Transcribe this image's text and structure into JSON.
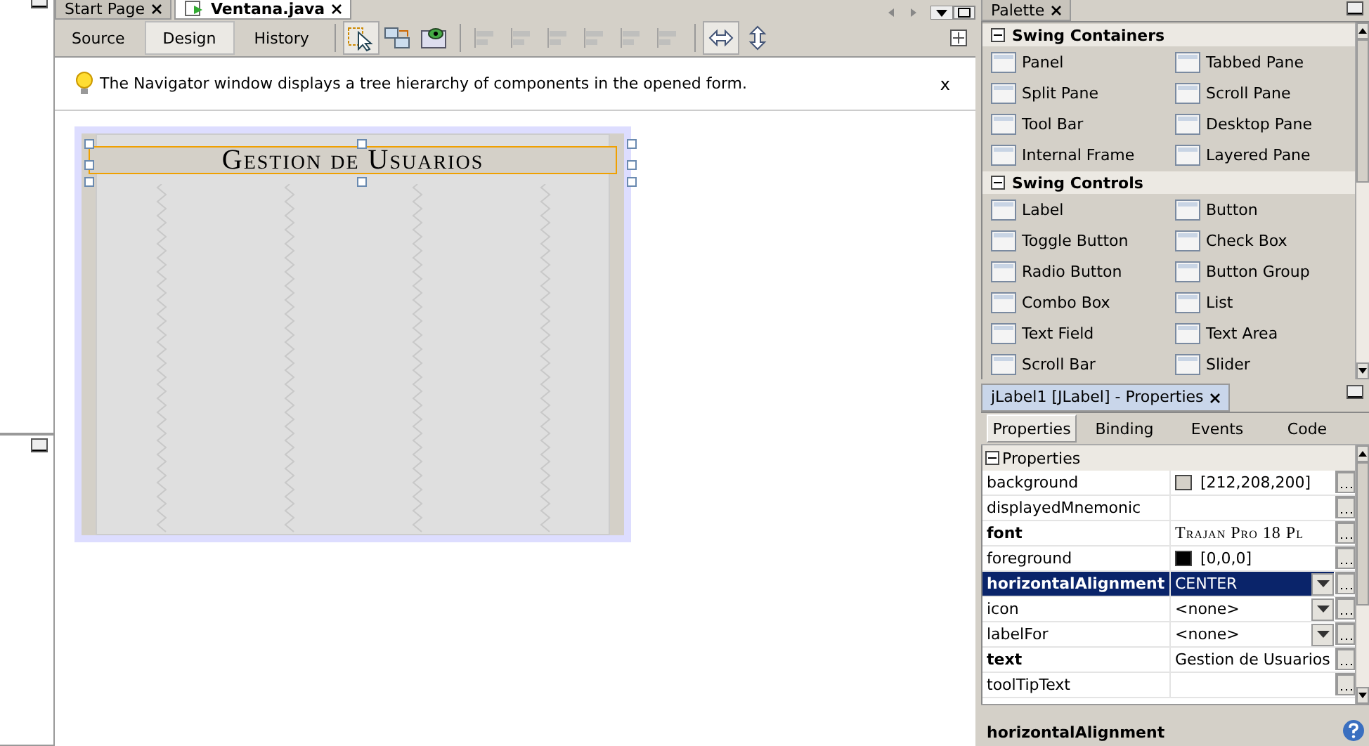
{
  "editor": {
    "tabs": [
      {
        "label": "Start Page",
        "selected": false
      },
      {
        "label": "Ventana.java",
        "selected": true
      }
    ],
    "view_tabs": [
      {
        "label": "Source",
        "selected": false
      },
      {
        "label": "Design",
        "selected": true
      },
      {
        "label": "History",
        "selected": false
      }
    ],
    "hint": {
      "text": "The Navigator window displays a tree hierarchy of components in the opened form.",
      "close": "x"
    },
    "form": {
      "label": "Gestion de Usuarios",
      "selected": true
    }
  },
  "palette": {
    "title": "Palette",
    "groups": [
      {
        "name": "Swing Containers",
        "expanded": true,
        "items": [
          "Panel",
          "Tabbed Pane",
          "Split Pane",
          "Scroll Pane",
          "Tool Bar",
          "Desktop Pane",
          "Internal Frame",
          "Layered Pane"
        ]
      },
      {
        "name": "Swing Controls",
        "expanded": true,
        "items": [
          "Label",
          "Button",
          "Toggle Button",
          "Check Box",
          "Radio Button",
          "Button Group",
          "Combo Box",
          "List",
          "Text Field",
          "Text Area",
          "Scroll Bar",
          "Slider"
        ]
      }
    ]
  },
  "properties": {
    "title": "jLabel1 [JLabel] - Properties",
    "tabs": [
      {
        "label": "Properties",
        "selected": true
      },
      {
        "label": "Binding",
        "selected": false
      },
      {
        "label": "Events",
        "selected": false
      },
      {
        "label": "Code",
        "selected": false
      }
    ],
    "section": {
      "name": "Properties",
      "expanded": true
    },
    "rows": [
      {
        "name": "background",
        "bold": false,
        "kind": "color",
        "value": "[212,208,200]",
        "color": "#d4d0c8",
        "selected": false
      },
      {
        "name": "displayedMnemonic",
        "bold": false,
        "kind": "text",
        "value": "",
        "selected": false
      },
      {
        "name": "font",
        "bold": true,
        "kind": "font",
        "value": "Trajan Pro 18 Pl",
        "selected": false
      },
      {
        "name": "foreground",
        "bold": false,
        "kind": "color",
        "value": "[0,0,0]",
        "color": "#000000",
        "selected": false
      },
      {
        "name": "horizontalAlignment",
        "bold": true,
        "kind": "combo",
        "value": "CENTER",
        "selected": true
      },
      {
        "name": "icon",
        "bold": false,
        "kind": "combo",
        "value": "<none>",
        "selected": false
      },
      {
        "name": "labelFor",
        "bold": false,
        "kind": "combo",
        "value": "<none>",
        "selected": false
      },
      {
        "name": "text",
        "bold": true,
        "kind": "text",
        "value": "Gestion de Usuarios",
        "selected": false
      },
      {
        "name": "toolTipText",
        "bold": false,
        "kind": "text",
        "value": "",
        "selected": false
      }
    ],
    "description": "horizontalAlignment"
  }
}
